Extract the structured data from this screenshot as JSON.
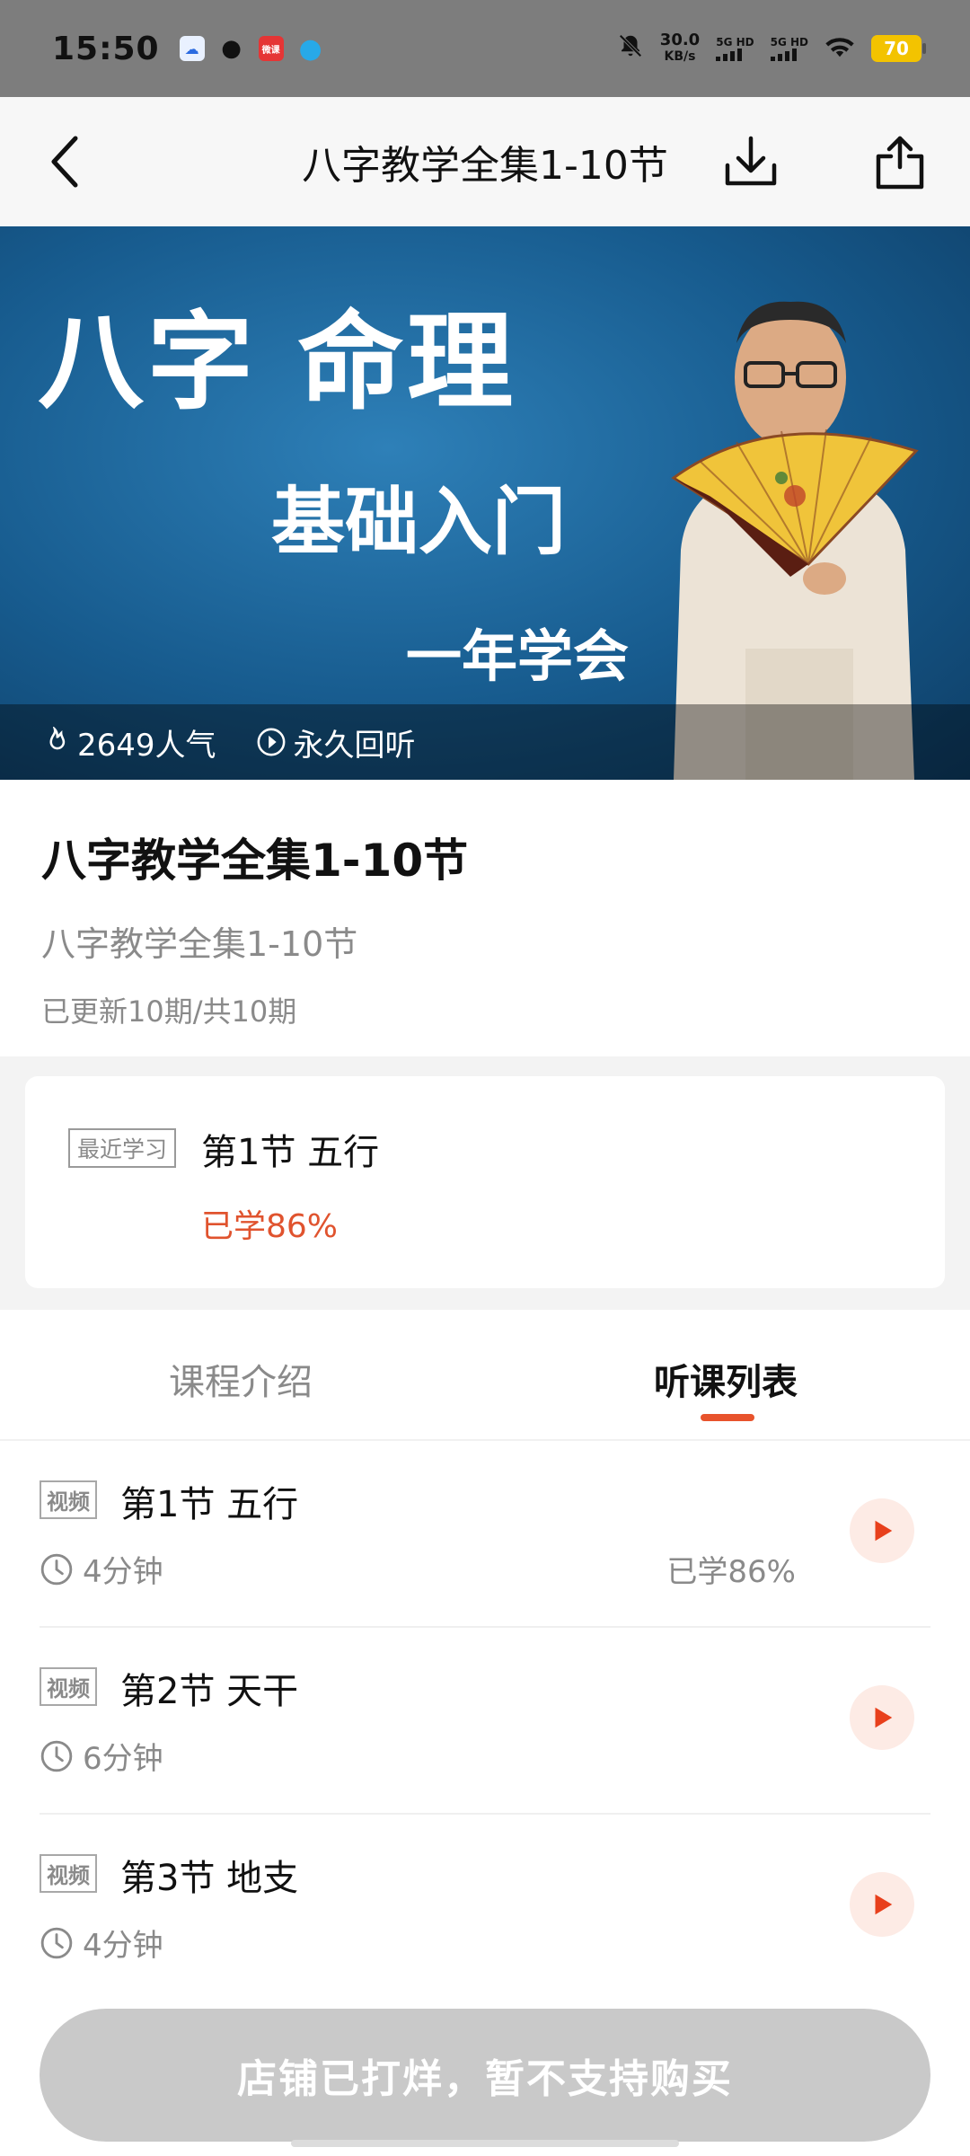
{
  "status_bar": {
    "time": "15:50",
    "app_icons": [
      "cloud-app-icon",
      "wechat-icon",
      "weike-icon",
      "drop-icon"
    ],
    "app_badge_text": "微课",
    "net_speed": "30.0",
    "net_unit": "KB/s",
    "signal1_label": "5G HD",
    "signal2_label": "5G HD",
    "battery": "70"
  },
  "header": {
    "title": "八字教学全集1-10节",
    "back_icon": "chevron-left-icon",
    "download_icon": "download-icon",
    "share_icon": "share-icon"
  },
  "banner": {
    "line1": "八字 命理",
    "line2": "基础入门",
    "line3": "一年学会",
    "popularity": "2649人气",
    "replay": "永久回听",
    "colors": {
      "bg": "#175b8e"
    }
  },
  "course": {
    "title": "八字教学全集1-10节",
    "subtitle": "八字教学全集1-10节",
    "status": "已更新10期/共10期"
  },
  "recent": {
    "tag": "最近学习",
    "lesson": "第1节 五行",
    "progress": "已学86%"
  },
  "tabs": [
    {
      "label": "课程介绍",
      "active": false
    },
    {
      "label": "听课列表",
      "active": true
    }
  ],
  "lessons": [
    {
      "tag": "视频",
      "title": "第1节 五行",
      "duration": "4分钟",
      "progress": "已学86%"
    },
    {
      "tag": "视频",
      "title": "第2节 天干",
      "duration": "6分钟",
      "progress": ""
    },
    {
      "tag": "视频",
      "title": "第3节 地支",
      "duration": "4分钟",
      "progress": ""
    }
  ],
  "bottom": {
    "buy_label": "店铺已打烊，暂不支持购买"
  },
  "colors": {
    "accent": "#e8532c",
    "muted": "#8a8a8a"
  }
}
